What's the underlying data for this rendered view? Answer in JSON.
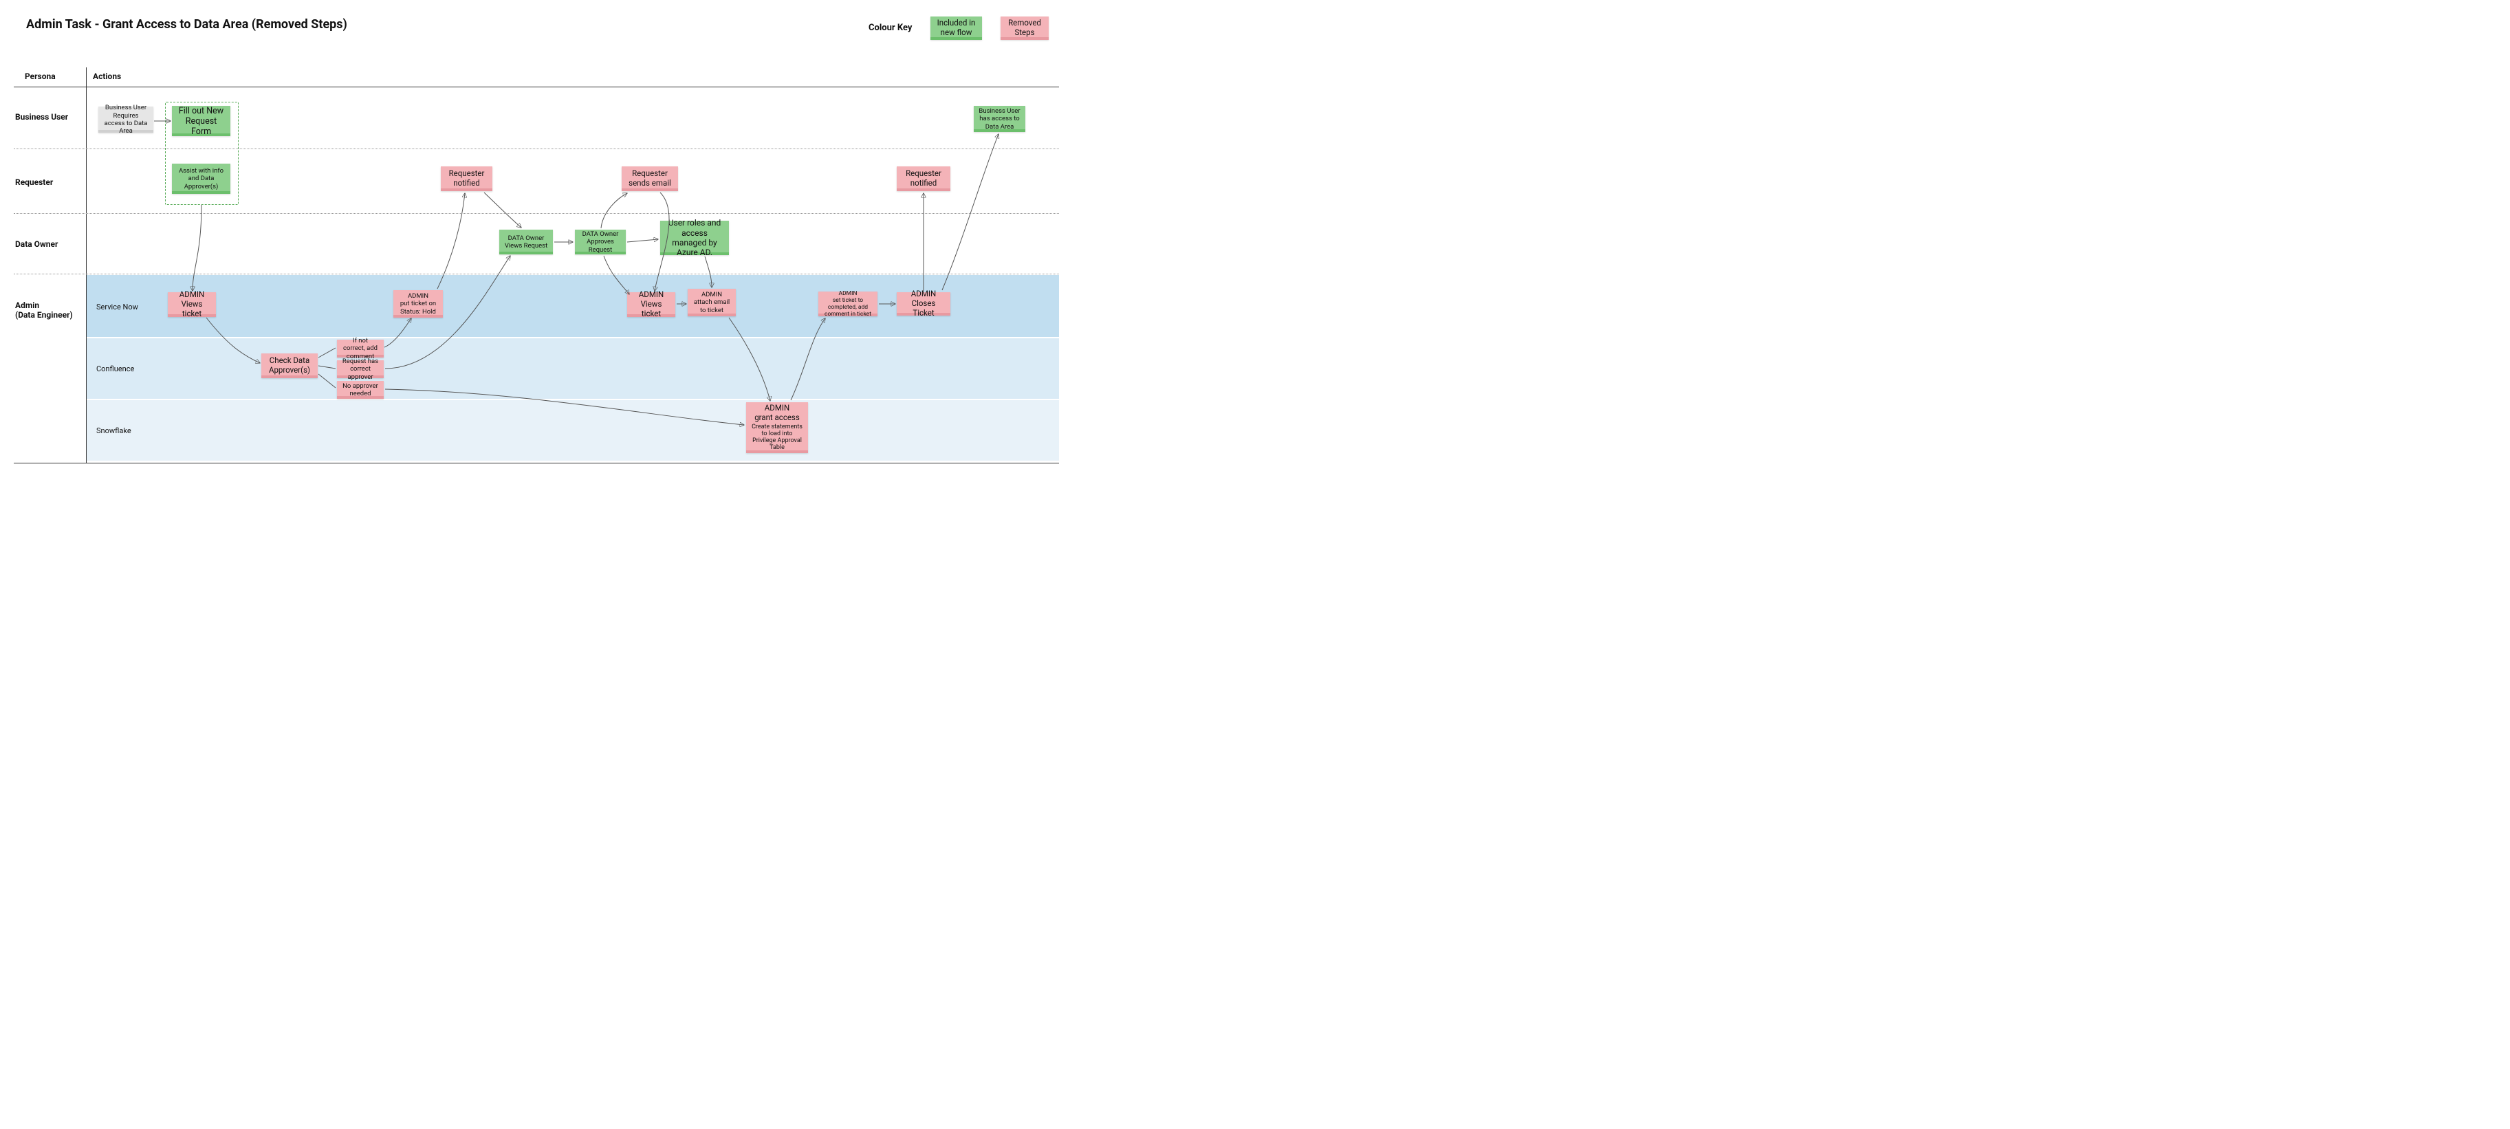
{
  "title": "Admin Task - Grant Access to Data Area (Removed Steps)",
  "legend": {
    "label": "Colour Key",
    "included": "Included in new flow",
    "removed": "Removed Steps"
  },
  "columns": {
    "persona": "Persona",
    "actions": "Actions"
  },
  "lanes": {
    "business_user": "Business User",
    "requester": "Requester",
    "data_owner": "Data Owner",
    "admin": "Admin\n(Data Engineer)"
  },
  "sublanes": {
    "service_now": "Service Now",
    "confluence": "Confluence",
    "snowflake": "Snowflake"
  },
  "notes": {
    "bu_requires": "Business User Requires access to Data Area",
    "fill_form": "Fill out New Request Form",
    "assist_info": "Assist with info and Data Approver(s)",
    "bu_has_access": "Business User has access to Data Area",
    "req_notified_1": "Requester notified",
    "req_sends_email": "Requester sends email",
    "req_notified_2": "Requester notified",
    "do_views": "DATA Owner Views Request",
    "do_approves": "DATA Owner Approves Request",
    "azure_ad": "User roles and access managed by Azure AD.",
    "admin_views_1": "ADMIN\nViews ticket",
    "admin_hold": "ADMIN\nput ticket on Status: Hold",
    "admin_views_2": "ADMIN\nViews ticket",
    "admin_attach": "ADMIN\nattach email to ticket",
    "admin_complete": "ADMIN\nset ticket to completed, add comment in ticket",
    "admin_close": "ADMIN\nCloses Ticket",
    "check_approvers": "Check Data Approver(s)",
    "if_not_correct": "If not correct, add comment",
    "has_approver": "Request has correct approver",
    "no_approver": "No approver needed",
    "admin_grant_title": "ADMIN\ngrant access",
    "admin_grant_sub": "Create statements to load into Privilege Approval Table"
  }
}
